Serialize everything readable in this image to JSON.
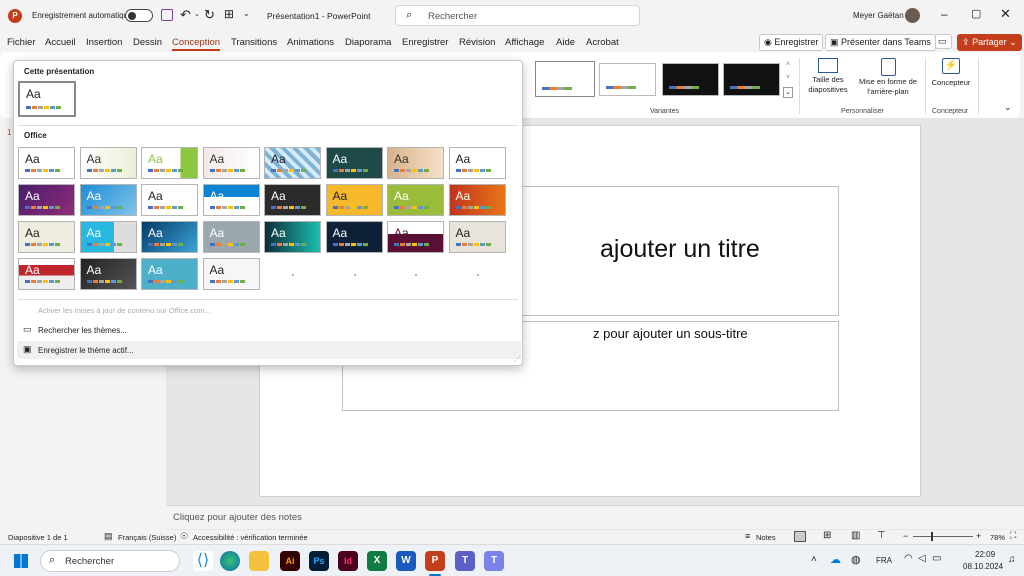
{
  "titlebar": {
    "autosave_label": "Enregistrement automatique",
    "doc_title": "Présentation1  -  PowerPoint",
    "search_placeholder": "Rechercher",
    "user_name": "Meyer Gaëtan"
  },
  "menu": [
    "Fichier",
    "Accueil",
    "Insertion",
    "Dessin",
    "Conception",
    "Transitions",
    "Animations",
    "Diaporama",
    "Enregistrer",
    "Révision",
    "Affichage",
    "Aide",
    "Acrobat"
  ],
  "menu_active": "Conception",
  "top_right": {
    "record": "Enregistrer",
    "teams": "Présenter dans Teams",
    "share": "Partager"
  },
  "ribbon": {
    "variants_label": "Variantes",
    "slide_size": "Taille des diapositives",
    "format_bg": "Mise en forme de l'arrière-plan",
    "personaliser_label": "Personnaliser",
    "designer": "Concepteur",
    "designer_group": "Concepteur"
  },
  "gallery": {
    "this_presentation": "Cette présentation",
    "office": "Office",
    "aa": "Aa",
    "update_link": "Activer les mises à jour de contenu sur Office.com...",
    "search_themes": "Rechercher les thèmes...",
    "save_theme": "Enregistrer le thème actif..."
  },
  "slide": {
    "title": "ajouter un titre",
    "subtitle": "z pour ajouter un sous-titre",
    "slide_number": "1"
  },
  "notes_placeholder": "Cliquez pour ajouter des notes",
  "status": {
    "slide_info": "Diapositive 1 de 1",
    "language": "Français (Suisse)",
    "accessibility": "Accessibilité : vérification terminée",
    "notes": "Notes",
    "zoom": "78%"
  },
  "taskbar": {
    "search": "Rechercher",
    "lang": "FRA",
    "time": "22:09",
    "date": "08.10.2024"
  },
  "colors": {
    "accent": "#c43e1c",
    "ribbon_bg": "#ffffff",
    "chrome": "#f3f3f3"
  }
}
